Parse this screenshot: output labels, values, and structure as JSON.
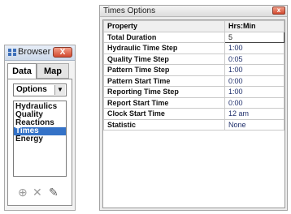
{
  "browser": {
    "title": "Browser",
    "close_label": "X",
    "tabs": [
      "Data",
      "Map"
    ],
    "options_select": "Options",
    "items": [
      "Hydraulics",
      "Quality",
      "Reactions",
      "Times",
      "Energy"
    ],
    "selected_item": "Times",
    "toolbar": {
      "add": "⊕",
      "delete": "✕",
      "edit": "✎"
    }
  },
  "times_options": {
    "title": "Times Options",
    "close_label": "x",
    "columns": [
      "Property",
      "Hrs:Min"
    ],
    "rows": [
      {
        "property": "Total Duration",
        "value": "5"
      },
      {
        "property": "Hydraulic Time Step",
        "value": "1:00"
      },
      {
        "property": "Quality Time Step",
        "value": "0:05"
      },
      {
        "property": "Pattern Time Step",
        "value": "1:00"
      },
      {
        "property": "Pattern Start Time",
        "value": "0:00"
      },
      {
        "property": "Reporting Time Step",
        "value": "1:00"
      },
      {
        "property": "Report Start Time",
        "value": "0:00"
      },
      {
        "property": "Clock Start Time",
        "value": "12 am"
      },
      {
        "property": "Statistic",
        "value": "None"
      }
    ]
  }
}
